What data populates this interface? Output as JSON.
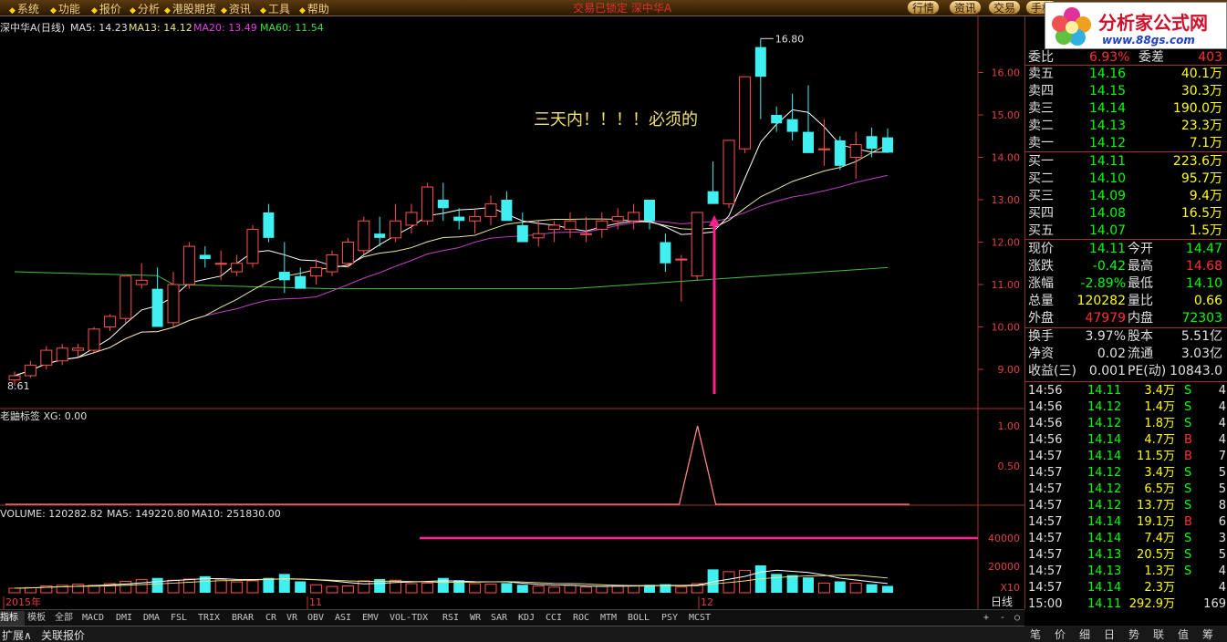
{
  "menu": [
    {
      "x": 10,
      "label": "系统"
    },
    {
      "x": 55,
      "label": "功能"
    },
    {
      "x": 100,
      "label": "报价"
    },
    {
      "x": 142,
      "label": "分析"
    },
    {
      "x": 180,
      "label": "港股期货"
    },
    {
      "x": 242,
      "label": "资讯"
    },
    {
      "x": 285,
      "label": "工具"
    },
    {
      "x": 328,
      "label": "帮助"
    }
  ],
  "center_title": "交易已锁定   深中华A",
  "top_right_buttons": [
    "行情",
    "资讯",
    "交易",
    "手机"
  ],
  "logo": {
    "title": "分析家公式网",
    "url": "www.88gs.com"
  },
  "price_header": {
    "name": "深中华A(日线)",
    "ma5": "MA5: 14.23",
    "ma13": "MA13: 14.12",
    "ma20": "MA20: 13.49",
    "ma60": "MA60: 11.54"
  },
  "annotation_text": "三天内！！！！必须的",
  "high_label": "16.80",
  "low_label": "8.61",
  "indicator_header": "老鼬标签  XG: 0.00",
  "volume_header": {
    "vol": "VOLUME: 120282.82",
    "ma5": "MA5: 149220.80",
    "ma10": "MA10: 251830.00"
  },
  "x_axis_labels": [
    "2015年",
    "11",
    "12"
  ],
  "period_label": "日线",
  "price_axis": [
    "16.00",
    "15.00",
    "14.00",
    "13.00",
    "12.00",
    "11.00",
    "10.00",
    "9.00"
  ],
  "ind_axis": [
    "1.00",
    "0.50"
  ],
  "vol_axis": [
    "40000",
    "20000",
    "X10"
  ],
  "bottom_tabs": [
    "指标",
    "模板",
    "全部",
    "MACD",
    "DMI",
    "DMA",
    "FSL",
    "TRIX",
    "BRAR",
    "CR",
    "VR",
    "OBV",
    "ASI",
    "EMV",
    "VOL-TDX",
    "RSI",
    "WR",
    "SAR",
    "KDJ",
    "CCI",
    "ROC",
    "MTM",
    "BOLL",
    "PSY",
    "MCST"
  ],
  "status": {
    "expand": "扩展∧",
    "link": "关联报价"
  },
  "quote": {
    "stub_label": "委比",
    "stub_v": "6.93%",
    "stub_l2": "委差",
    "stub_v2": "403",
    "asks": [
      {
        "l": "卖五",
        "p": "14.16",
        "v": "40.1万"
      },
      {
        "l": "卖四",
        "p": "14.15",
        "v": "30.3万"
      },
      {
        "l": "卖三",
        "p": "14.14",
        "v": "190.0万"
      },
      {
        "l": "卖二",
        "p": "14.13",
        "v": "23.3万"
      },
      {
        "l": "卖一",
        "p": "14.12",
        "v": "7.1万"
      }
    ],
    "bids": [
      {
        "l": "买一",
        "p": "14.11",
        "v": "223.6万"
      },
      {
        "l": "买二",
        "p": "14.10",
        "v": "95.7万"
      },
      {
        "l": "买三",
        "p": "14.09",
        "v": "9.4万"
      },
      {
        "l": "买四",
        "p": "14.08",
        "v": "16.5万"
      },
      {
        "l": "买五",
        "p": "14.07",
        "v": "1.5万"
      }
    ],
    "stats": [
      {
        "l1": "现价",
        "v1": "14.11",
        "c1": "#00ff00",
        "l2": "今开",
        "v2": "14.47",
        "c2": "#00ff00"
      },
      {
        "l1": "涨跌",
        "v1": "-0.42",
        "c1": "#00ff00",
        "l2": "最高",
        "v2": "14.68",
        "c2": "#ff3030"
      },
      {
        "l1": "涨幅",
        "v1": "-2.89%",
        "c1": "#00ff00",
        "l2": "最低",
        "v2": "14.10",
        "c2": "#00ff00"
      },
      {
        "l1": "总量",
        "v1": "120282",
        "c1": "#ffff00",
        "l2": "量比",
        "v2": "0.66",
        "c2": "#ffff00"
      },
      {
        "l1": "外盘",
        "v1": "47979",
        "c1": "#ff3030",
        "l2": "内盘",
        "v2": "72303",
        "c2": "#00ff00"
      }
    ],
    "stats2": [
      {
        "l1": "换手",
        "v1": "3.97%",
        "l2": "股本",
        "v2": "5.51亿"
      },
      {
        "l1": "净资",
        "v1": "0.02",
        "l2": "流通",
        "v2": "3.03亿"
      },
      {
        "l1": "收益(三)",
        "v1": "0.001",
        "l2": "PE(动)",
        "v2": "10843.0"
      }
    ]
  },
  "ticks": [
    {
      "t": "14:56",
      "p": "14.11",
      "v": "3.4万",
      "s": "S",
      "n": "4"
    },
    {
      "t": "14:56",
      "p": "14.12",
      "v": "1.4万",
      "s": "S",
      "n": "4"
    },
    {
      "t": "14:56",
      "p": "14.12",
      "v": "1.8万",
      "s": "S",
      "n": "4"
    },
    {
      "t": "14:56",
      "p": "14.14",
      "v": "4.7万",
      "s": "B",
      "n": "4"
    },
    {
      "t": "14:57",
      "p": "14.14",
      "v": "11.5万",
      "s": "B",
      "n": "7"
    },
    {
      "t": "14:57",
      "p": "14.12",
      "v": "3.4万",
      "s": "S",
      "n": "5"
    },
    {
      "t": "14:57",
      "p": "14.12",
      "v": "6.5万",
      "s": "S",
      "n": "5"
    },
    {
      "t": "14:57",
      "p": "14.12",
      "v": "13.7万",
      "s": "S",
      "n": "8"
    },
    {
      "t": "14:57",
      "p": "14.14",
      "v": "19.1万",
      "s": "B",
      "n": "6"
    },
    {
      "t": "14:57",
      "p": "14.14",
      "v": "7.4万",
      "s": "S",
      "n": "3"
    },
    {
      "t": "14:57",
      "p": "14.13",
      "v": "20.5万",
      "s": "S",
      "n": "5"
    },
    {
      "t": "14:57",
      "p": "14.13",
      "v": "1.3万",
      "s": "S",
      "n": "4"
    },
    {
      "t": "14:57",
      "p": "14.14",
      "v": "2.3万",
      "s": "",
      "n": "4"
    },
    {
      "t": "15:00",
      "p": "14.11",
      "v": "292.9万",
      "s": "",
      "n": "169"
    }
  ],
  "right_tabs": [
    "笔",
    "价",
    "细",
    "日",
    "势",
    "联",
    "值",
    "筹"
  ],
  "chart_data": {
    "type": "candlestick",
    "candles": [
      [
        8.75,
        8.95,
        8.61,
        8.85
      ],
      [
        8.85,
        9.2,
        8.8,
        9.1
      ],
      [
        9.1,
        9.55,
        9.0,
        9.45
      ],
      [
        9.2,
        9.6,
        9.1,
        9.5
      ],
      [
        9.45,
        9.6,
        9.3,
        9.5
      ],
      [
        9.45,
        10.0,
        9.4,
        9.95
      ],
      [
        10.0,
        10.3,
        9.9,
        10.25
      ],
      [
        10.2,
        11.1,
        10.1,
        11.2
      ],
      [
        11.0,
        11.5,
        10.9,
        11.1
      ],
      [
        10.9,
        11.4,
        10.5,
        10.0
      ],
      [
        10.1,
        11.3,
        10.0,
        11.0
      ],
      [
        11.0,
        12.0,
        10.9,
        11.9
      ],
      [
        11.7,
        11.9,
        11.4,
        11.6
      ],
      [
        11.5,
        11.8,
        11.1,
        11.5
      ],
      [
        11.3,
        11.7,
        11.2,
        11.5
      ],
      [
        11.5,
        12.4,
        11.4,
        12.3
      ],
      [
        12.7,
        12.9,
        12.0,
        12.1
      ],
      [
        11.3,
        12.0,
        10.8,
        11.1
      ],
      [
        11.2,
        11.4,
        10.9,
        10.9
      ],
      [
        11.2,
        11.6,
        11.0,
        11.4
      ],
      [
        11.3,
        11.8,
        11.2,
        11.7
      ],
      [
        11.5,
        12.1,
        11.4,
        12.0
      ],
      [
        11.8,
        12.6,
        11.7,
        12.5
      ],
      [
        12.2,
        12.6,
        11.9,
        12.1
      ],
      [
        12.1,
        12.9,
        12.0,
        12.5
      ],
      [
        12.4,
        12.9,
        12.2,
        12.7
      ],
      [
        12.5,
        13.4,
        12.4,
        13.3
      ],
      [
        13.0,
        13.4,
        12.5,
        12.8
      ],
      [
        12.6,
        12.8,
        12.3,
        12.5
      ],
      [
        12.5,
        12.8,
        12.2,
        12.6
      ],
      [
        12.6,
        13.1,
        12.4,
        12.9
      ],
      [
        13.0,
        13.2,
        12.6,
        12.5
      ],
      [
        12.4,
        12.7,
        12.0,
        12.0
      ],
      [
        12.1,
        12.5,
        11.9,
        12.2
      ],
      [
        12.3,
        12.5,
        12.0,
        12.4
      ],
      [
        12.3,
        12.7,
        12.1,
        12.5
      ],
      [
        12.2,
        12.6,
        12.0,
        12.2
      ],
      [
        12.3,
        12.7,
        12.1,
        12.5
      ],
      [
        12.5,
        12.8,
        12.3,
        12.6
      ],
      [
        12.5,
        12.9,
        12.3,
        12.7
      ],
      [
        13.0,
        13.0,
        12.3,
        12.5
      ],
      [
        12.0,
        12.2,
        11.3,
        11.5
      ],
      [
        11.6,
        11.7,
        10.6,
        11.6
      ],
      [
        11.2,
        12.7,
        11.1,
        12.7
      ],
      [
        13.2,
        13.9,
        12.9,
        12.9
      ],
      [
        12.9,
        14.4,
        12.8,
        14.4
      ],
      [
        14.2,
        15.9,
        14.1,
        15.9
      ],
      [
        16.6,
        16.8,
        14.9,
        15.9
      ],
      [
        15.0,
        15.2,
        14.6,
        14.8
      ],
      [
        14.9,
        15.5,
        14.4,
        14.6
      ],
      [
        14.6,
        15.7,
        14.4,
        14.1
      ],
      [
        14.2,
        14.9,
        13.8,
        14.2
      ],
      [
        14.4,
        14.5,
        13.7,
        13.8
      ],
      [
        14.0,
        14.6,
        13.5,
        14.3
      ],
      [
        14.5,
        14.7,
        14.0,
        14.2
      ],
      [
        14.47,
        14.68,
        14.1,
        14.11
      ]
    ],
    "volume": [
      800,
      900,
      1200,
      1300,
      1500,
      1300,
      1600,
      2000,
      2300,
      2600,
      2200,
      2400,
      2900,
      2300,
      1900,
      2100,
      2600,
      3300,
      2000,
      1400,
      1100,
      1200,
      2100,
      2400,
      2200,
      1600,
      1700,
      2600,
      2200,
      1600,
      1500,
      1700,
      1400,
      1200,
      1000,
      1300,
      1000,
      1100,
      1300,
      1200,
      1400,
      1500,
      1000,
      1600,
      4100,
      3700,
      3900,
      4800,
      3300,
      3100,
      2700,
      1700,
      2000,
      1700,
      1500,
      1200
    ],
    "xg_signal_index": 44,
    "ylim": [
      8.0,
      17.0
    ]
  }
}
